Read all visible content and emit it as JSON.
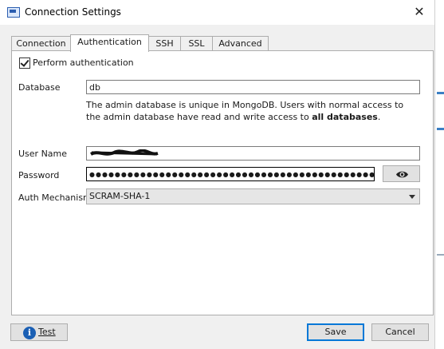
{
  "window": {
    "title": "Connection Settings",
    "close_glyph": "✕"
  },
  "tabs": [
    {
      "label": "Connection"
    },
    {
      "label": "Authentication"
    },
    {
      "label": "SSH"
    },
    {
      "label": "SSL"
    },
    {
      "label": "Advanced"
    }
  ],
  "auth": {
    "perform_auth_label": "Perform authentication",
    "perform_auth_checked": true,
    "database_label": "Database",
    "database_value": "db",
    "help_text_1": "The admin database is unique in MongoDB. Users with normal access to the admin database have read and write access to ",
    "help_text_bold": "all databases",
    "help_text_end": ".",
    "username_label": "User Name",
    "password_label": "Password",
    "password_mask": "●●●●●●●●●●●●●●●●●●●●●●●●●●●●●●●●●●●●●●●●●●●●●●●●●●●●",
    "mechanism_label": "Auth Mechanism",
    "mechanism_value": "SCRAM-SHA-1"
  },
  "footer": {
    "test_label": "Test",
    "save_label": "Save",
    "cancel_label": "Cancel"
  },
  "colors": {
    "accent": "#0078d7",
    "info": "#1a5fb4"
  }
}
